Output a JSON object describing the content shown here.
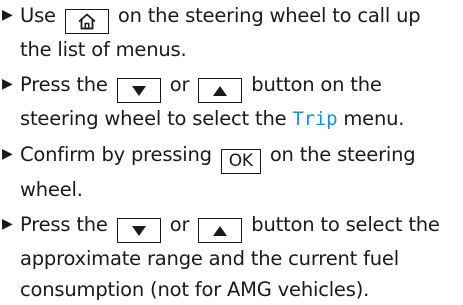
{
  "icons": {
    "home": "home-icon",
    "down": "down-arrow-icon",
    "up": "up-arrow-icon"
  },
  "colors": {
    "text": "#1a1a1a",
    "menu_highlight": "#1f8fd0"
  },
  "steps": [
    {
      "marker": "▶",
      "before": "Use",
      "after_line1": "on the steering wheel to call up",
      "line2": "the list of menus."
    },
    {
      "marker": "▶",
      "before": "Press the",
      "or": "or",
      "after_line1": "button on the",
      "line2_before": "steering wheel to select the",
      "menu_name": "Trip",
      "line2_after": "menu."
    },
    {
      "marker": "▶",
      "before": "Confirm by pressing",
      "ok_label": "OK",
      "after_line1": "on the steering",
      "line2": "wheel."
    },
    {
      "marker": "▶",
      "before": "Press the",
      "or": "or",
      "after_line1": "button to select the",
      "line2": "approximate range and the current fuel",
      "line3": "consumption (not for AMG vehicles)."
    }
  ]
}
